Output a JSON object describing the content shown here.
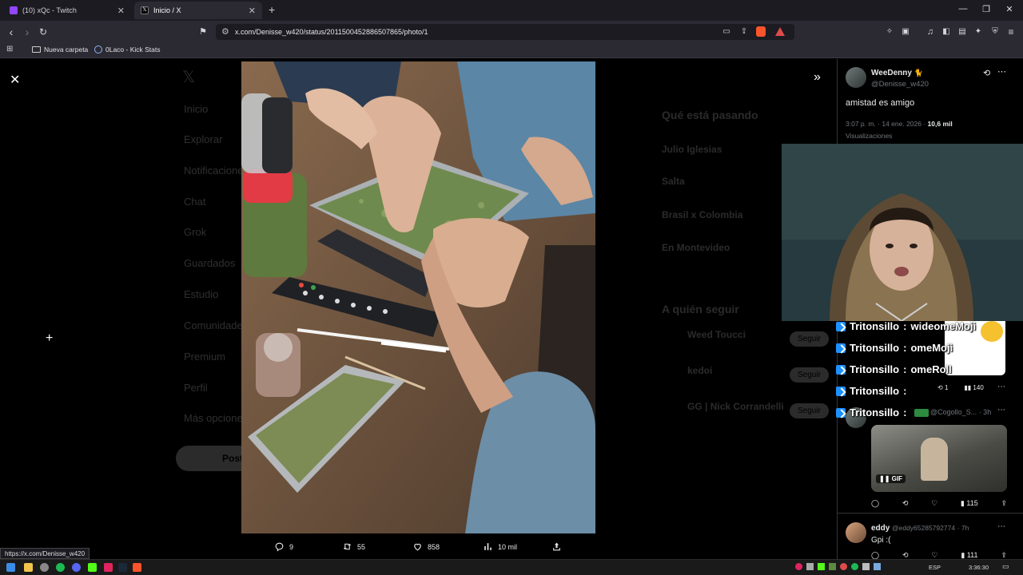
{
  "browser": {
    "tabs": [
      {
        "title": "(10) xQc - Twitch",
        "active": false,
        "icon": "twitch-icon"
      },
      {
        "title": "Inicio / X",
        "active": true,
        "icon": "x-icon"
      }
    ],
    "new_tab": "+",
    "url": "x.com/Denisse_w420/status/2011500452886507865/photo/1",
    "bookmarks": [
      {
        "label": "Nueva carpeta",
        "icon": "folder-icon"
      },
      {
        "label": "0Laco - Kick Stats",
        "icon": "kick-stats-icon"
      }
    ],
    "status_url": "https://x.com/Denisse_w420"
  },
  "background_feed": {
    "nav_items": [
      "Inicio",
      "Explorar",
      "Notificaciones",
      "Chat",
      "Grok",
      "Guardados",
      "Estudio",
      "Comunidades",
      "Premium",
      "Perfil",
      "Más opciones"
    ],
    "trends_title": "Qué está pasando",
    "trends": [
      "Julio Iglesias",
      "Salta",
      "Brasil x Colombia",
      "En Montevideo"
    ],
    "follow_title": "A quién seguir",
    "follow": [
      "Weed Toucci",
      "kedoi",
      "GG | Nick Corrandelli"
    ],
    "follow_button": "Seguir",
    "post_button": "Postear"
  },
  "photo_actions": {
    "replies": "9",
    "reposts": "55",
    "likes": "858",
    "views": "10 mil"
  },
  "tweet": {
    "display_name": "WeeDenny",
    "handle": "@Denisse_w420",
    "text": "amistad es amigo",
    "time": "3:07 p. m. · 14 ene. 2026 · ",
    "views_count": "10,6 mil",
    "views_label": "Visualizaciones"
  },
  "replies": [
    {
      "display_name": "",
      "handle": "@Cogollo_S...",
      "time": "· 3h",
      "media_badge": "GIF",
      "stats": {
        "views": "115"
      }
    },
    {
      "display_name": "eddy",
      "handle": "@eddy65285792774",
      "time": "· 7h",
      "text": "Gpi :(",
      "stats": {
        "views": "111"
      }
    }
  ],
  "hidden_reply_stats": {
    "views": "140",
    "reposts": "1"
  },
  "chat": [
    {
      "user": "Tritonsillo",
      "message": "wideomeMoji"
    },
    {
      "user": "Tritonsillo",
      "message": "omeMoji"
    },
    {
      "user": "Tritonsillo",
      "message": "omeRoll"
    },
    {
      "user": "Tritonsillo",
      "message": ""
    },
    {
      "user": "Tritonsillo",
      "message": ""
    }
  ],
  "taskbar": {
    "language": "ESP",
    "clock": "3:36:30"
  },
  "colors": {
    "browser_bg": "#2b2a33",
    "x_bg": "#000000",
    "chat_badge": "#1e90ff",
    "accent_red": "#e0245e"
  }
}
